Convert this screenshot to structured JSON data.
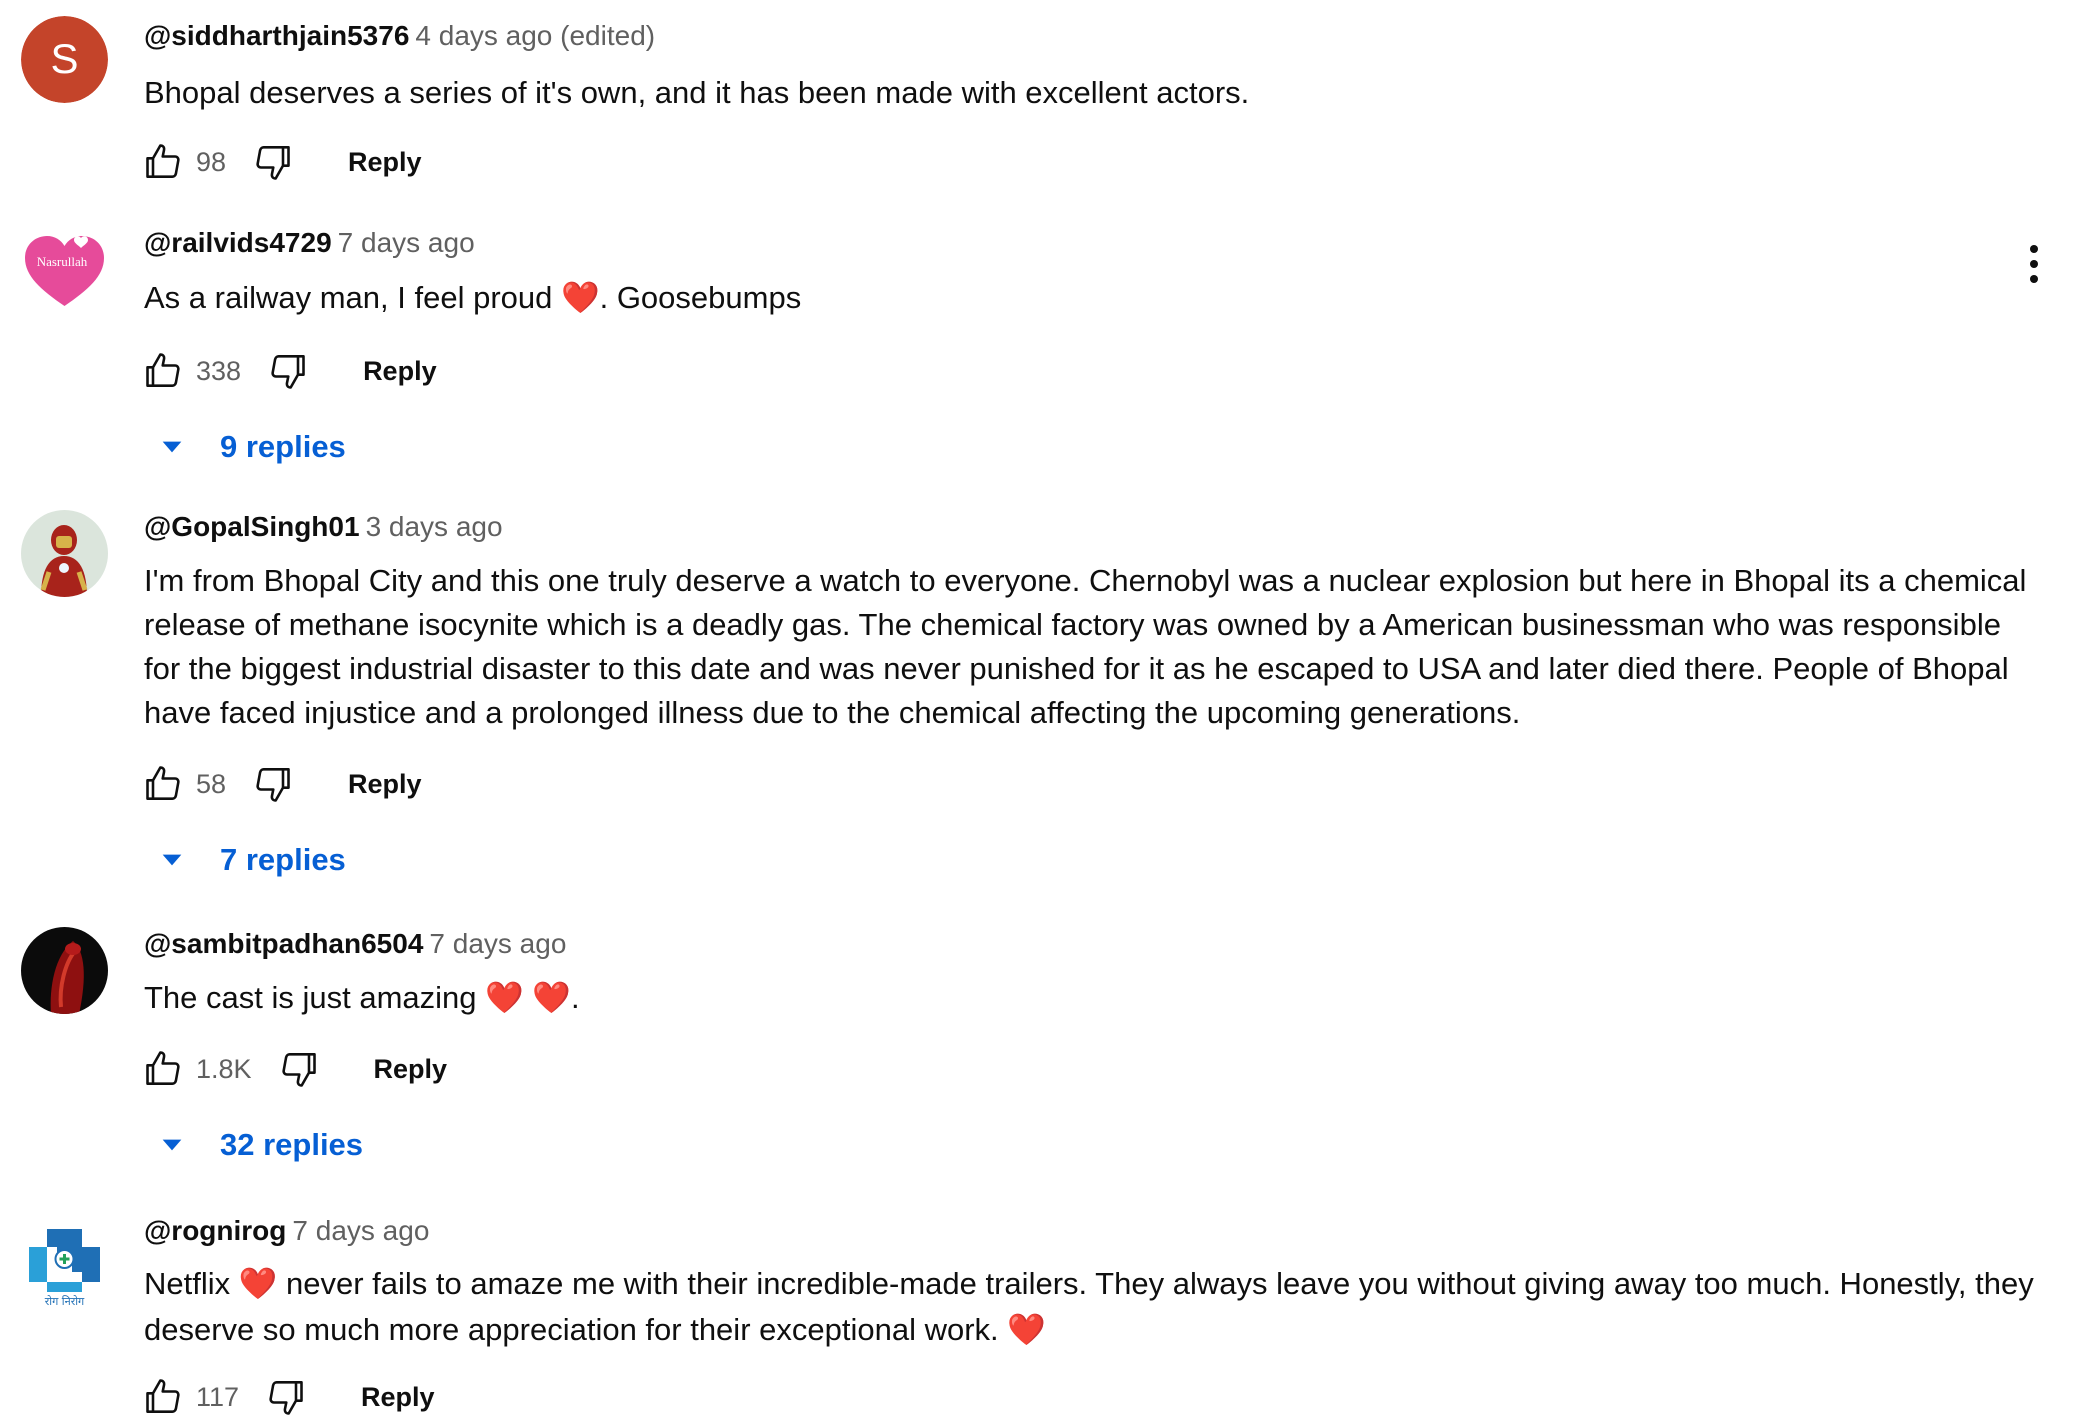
{
  "colors": {
    "link_blue": "#065fd4",
    "heart_red": "#e0262c",
    "muted": "#606060"
  },
  "actions": {
    "reply_label": "Reply",
    "more_actions_icon": "vertical-ellipsis-icon"
  },
  "comments": [
    {
      "author": "@siddharthjain5376",
      "time": "4 days ago (edited)",
      "avatar": {
        "icon": "letter-avatar",
        "letter": "S",
        "color": "#c4442a"
      },
      "text": "Bhopal deserves a series of it's own, and it has been made with excellent actors.",
      "likes": "98"
    },
    {
      "author": "@railvids4729",
      "time": "7 days ago",
      "avatar": {
        "icon": "pink-heart-avatar",
        "label": "Nasrullah",
        "color": "#e64b9a"
      },
      "text_before": "As a railway man, I feel proud ",
      "text_after": ". Goosebumps",
      "likes": "338",
      "replies": "9 replies"
    },
    {
      "author": "@GopalSingh01",
      "time": "3 days ago",
      "avatar": {
        "icon": "iron-man-avatar"
      },
      "text": "I'm from Bhopal City and this one truly deserve a watch to everyone. Chernobyl was a nuclear explosion but here in Bhopal its a chemical release of methane isocynite which is a deadly gas. The chemical factory was owned by a American businessman who was responsible for the biggest industrial disaster to this date and was never punished for it as he escaped to USA and later died there. People of Bhopal have faced injustice and a prolonged illness due to the chemical affecting the upcoming generations.",
      "likes": "58",
      "replies": "7 replies"
    },
    {
      "author": "@sambitpadhan6504",
      "time": "7 days ago",
      "avatar": {
        "icon": "dark-red-figure-avatar"
      },
      "text_before": "The cast is just amazing ",
      "text_after": ".",
      "likes": "1.8K",
      "replies": "32 replies"
    },
    {
      "author": "@rognirog",
      "time": "7 days ago",
      "avatar": {
        "icon": "medical-cross-logo-avatar",
        "label": "रोग निरोग",
        "color": "#1f6fb5"
      },
      "text_before": "Netflix ",
      "text_middle": " never fails to amaze me with their incredible-made trailers. They always leave you without giving away too much. Honestly, they deserve so much more appreciation for their exceptional work. ",
      "likes": "117"
    }
  ]
}
